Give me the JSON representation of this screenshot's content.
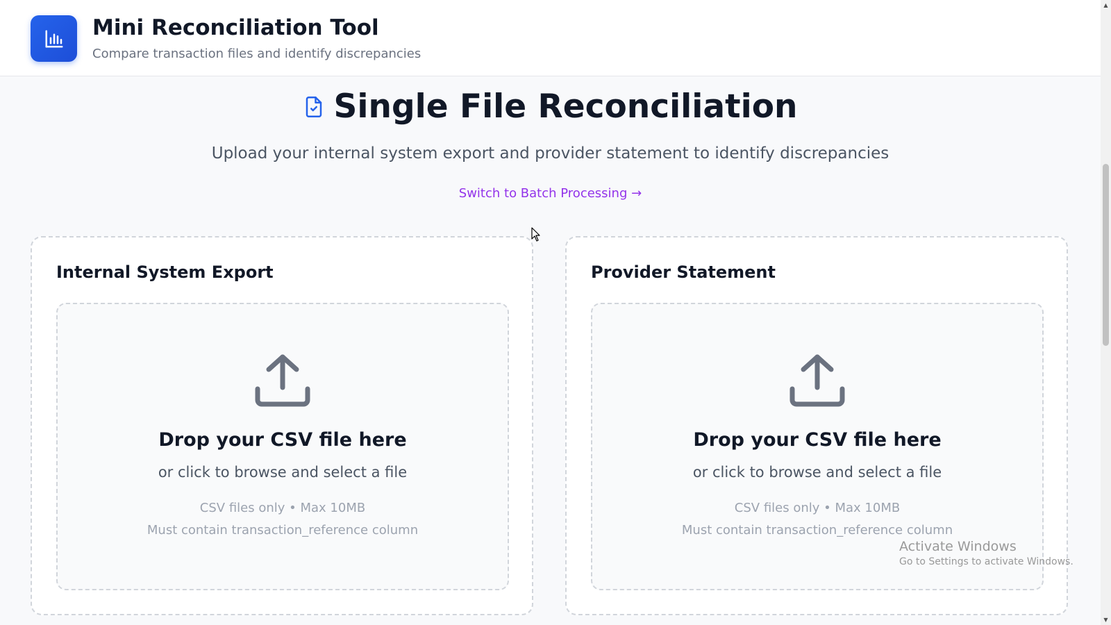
{
  "header": {
    "title": "Mini Reconciliation Tool",
    "subtitle": "Compare transaction files and identify discrepancies",
    "logo_icon": "bar-chart-icon"
  },
  "main": {
    "title": "Single File Reconciliation",
    "title_icon": "file-check-icon",
    "subtitle": "Upload your internal system export and provider statement to identify discrepancies",
    "switch_link": "Switch to Batch Processing →"
  },
  "panels": [
    {
      "title": "Internal System Export",
      "dropzone": {
        "icon": "upload-icon",
        "main_text": "Drop your CSV file here",
        "sub_text": "or click to browse and select a file",
        "hint_1": "CSV files only • Max 10MB",
        "hint_2": "Must contain transaction_reference column"
      }
    },
    {
      "title": "Provider Statement",
      "dropzone": {
        "icon": "upload-icon",
        "main_text": "Drop your CSV file here",
        "sub_text": "or click to browse and select a file",
        "hint_1": "CSV files only • Max 10MB",
        "hint_2": "Must contain transaction_reference column"
      }
    }
  ],
  "watermark": {
    "title": "Activate Windows",
    "subtitle": "Go to Settings to activate Windows."
  },
  "colors": {
    "brand": "#2563eb",
    "link": "#9333ea",
    "border": "#d1d5db"
  }
}
